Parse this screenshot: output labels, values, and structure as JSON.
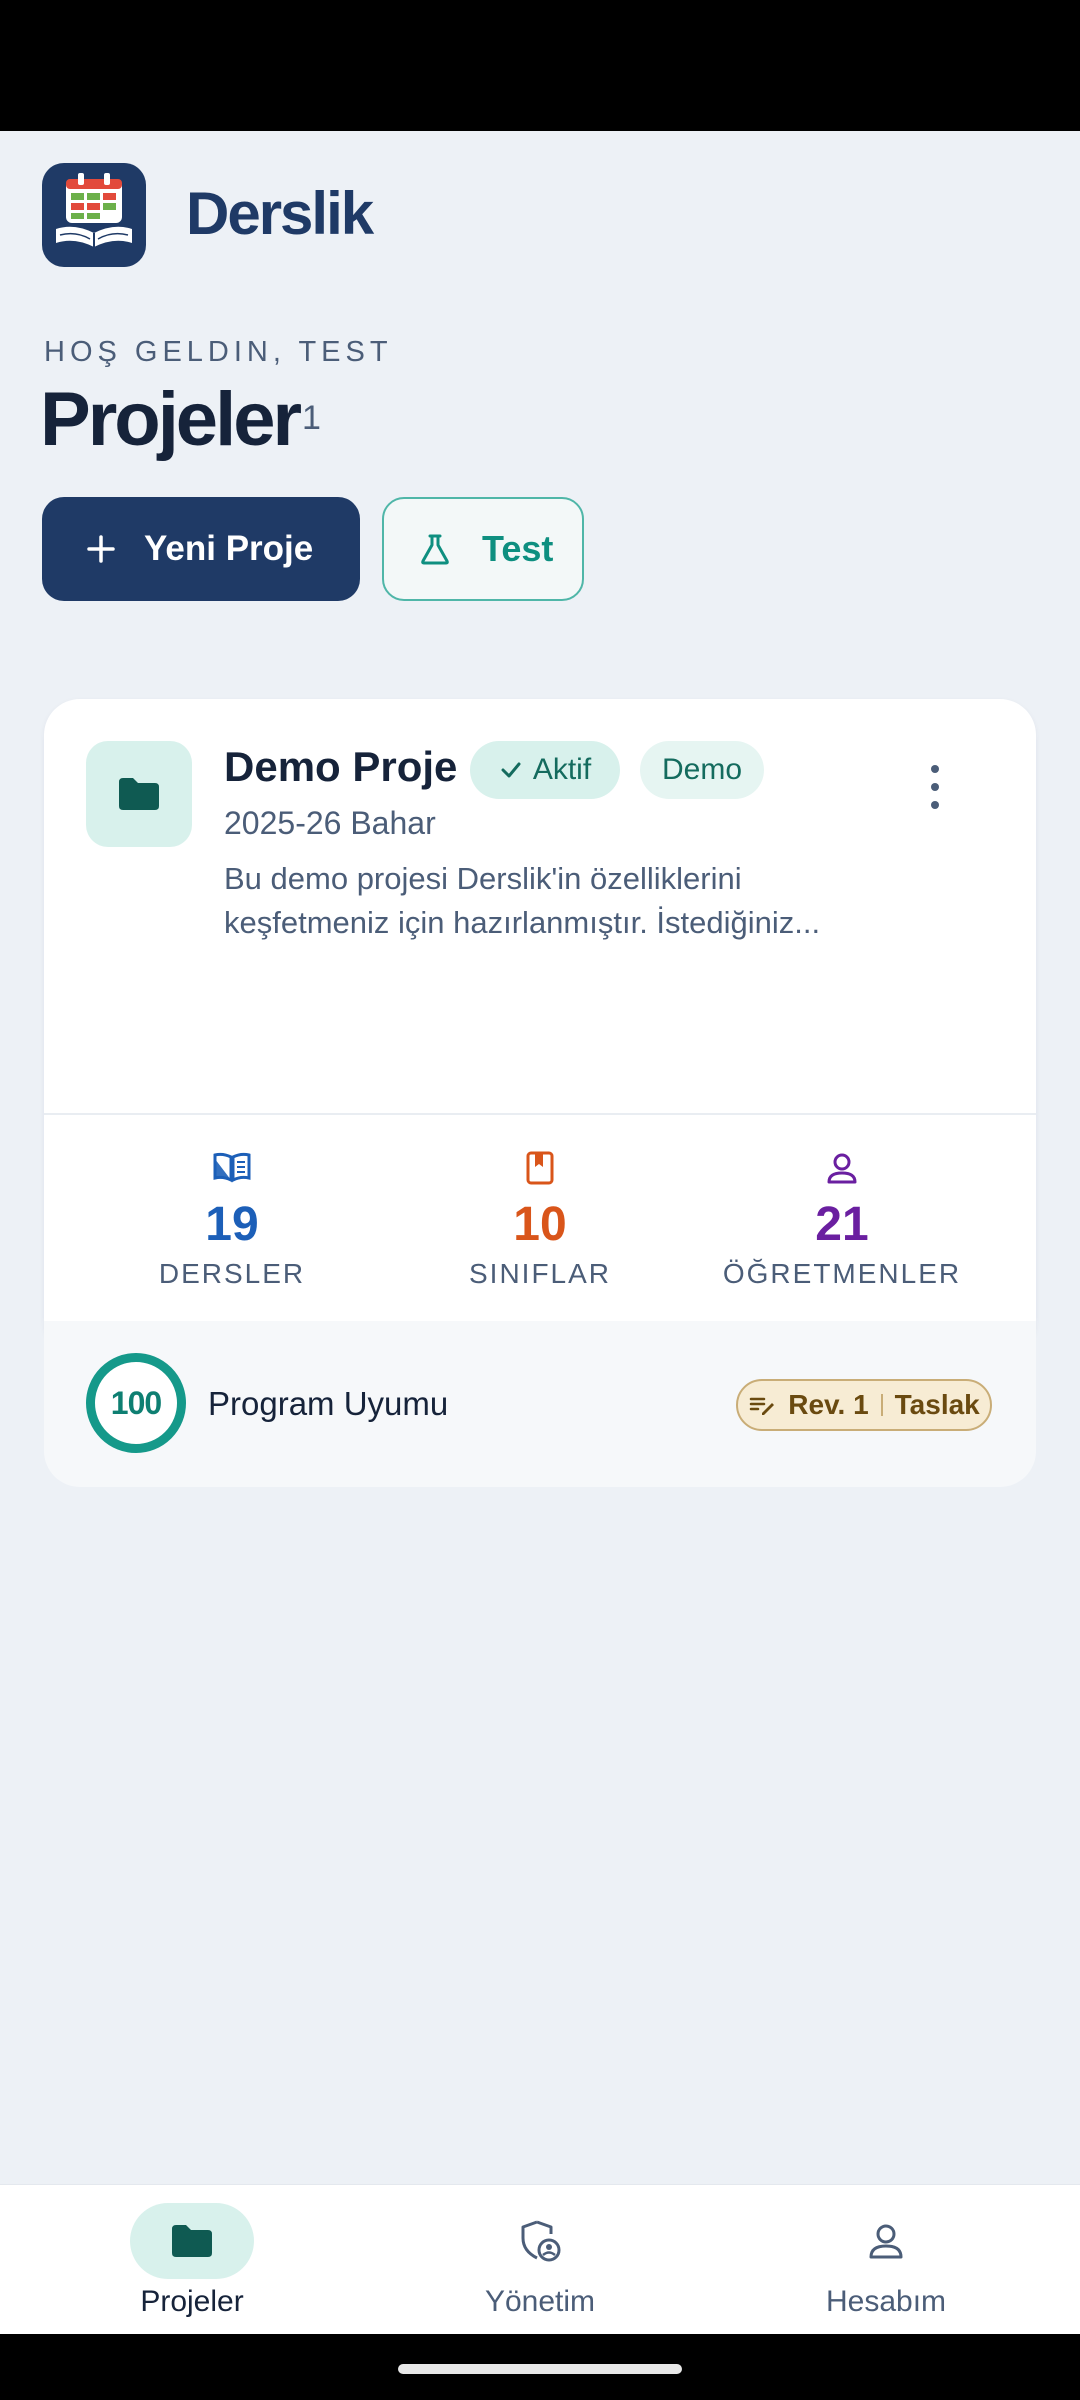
{
  "app": {
    "name": "Derslik"
  },
  "header": {
    "greeting": "HOŞ GELDIN, TEST",
    "title": "Projeler",
    "count": "1"
  },
  "actions": {
    "new_project": "Yeni Proje",
    "test": "Test"
  },
  "project": {
    "title": "Demo Proje",
    "badge_active": "Aktif",
    "badge_demo": "Demo",
    "term": "2025-26 Bahar",
    "description_line1": "Bu demo projesi Derslik'in özelliklerini",
    "description_line2": "keşfetmeniz için hazırlanmıştır. İstediğiniz...",
    "stats": [
      {
        "value": "19",
        "label": "DERSLER",
        "icon": "open-book-icon",
        "color": "#1c5fb8"
      },
      {
        "value": "10",
        "label": "SINIFLAR",
        "icon": "bookmark-book-icon",
        "color": "#d9551a"
      },
      {
        "value": "21",
        "label": "ÖĞRETMENLER",
        "icon": "person-icon",
        "color": "#6a1fa0"
      }
    ],
    "score": "100",
    "score_label": "Program Uyumu",
    "revision": "Rev. 1",
    "revision_status": "Taslak"
  },
  "nav": {
    "items": [
      {
        "label": "Projeler",
        "icon": "folder-icon",
        "active": true
      },
      {
        "label": "Yönetim",
        "icon": "shield-user-icon",
        "active": false
      },
      {
        "label": "Hesabım",
        "icon": "person-icon",
        "active": false
      }
    ]
  },
  "colors": {
    "primary": "#1f3a66",
    "accent": "#15998a",
    "background": "#edf1f6"
  }
}
